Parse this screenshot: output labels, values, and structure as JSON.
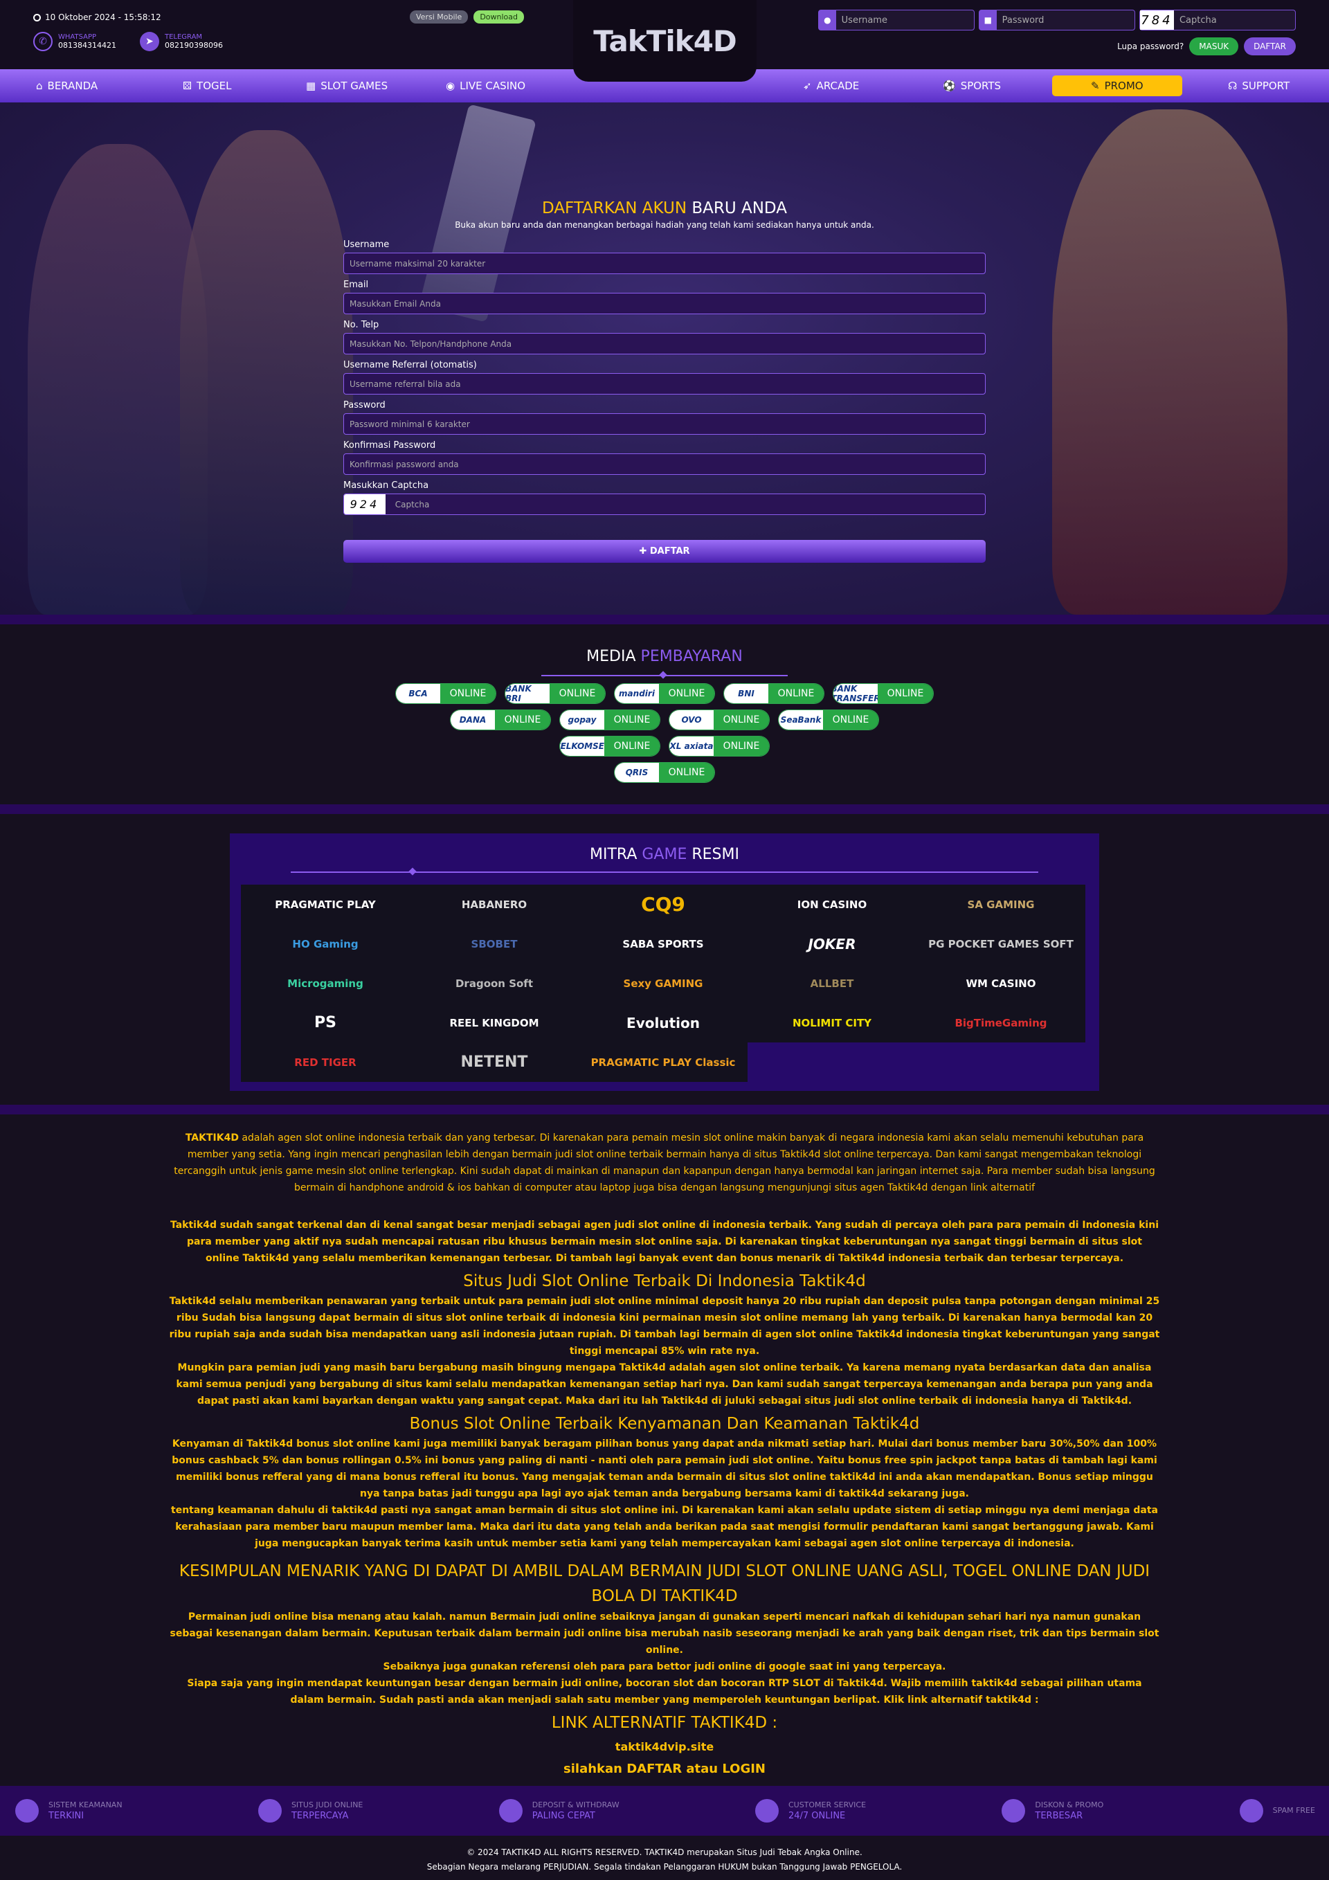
{
  "header": {
    "datetime": "10 Oktober 2024 - 15:58:12",
    "whatsapp_label": "WHATSAPP",
    "whatsapp_number": "081384314421",
    "telegram_label": "TELEGRAM",
    "telegram_number": "082190398096",
    "versi_mobile": "Versi Mobile",
    "download": "Download",
    "logo_text": "TakTik4D",
    "username_placeholder": "Username",
    "password_placeholder": "Password",
    "captcha_code": "784",
    "captcha_placeholder": "Captcha",
    "lupa_password": "Lupa password?",
    "masuk": "MASUK",
    "daftar": "DAFTAR"
  },
  "nav": {
    "items": [
      "BERANDA",
      "TOGEL",
      "SLOT GAMES",
      "LIVE CASINO",
      "ARCADE",
      "SPORTS",
      "PROMO",
      "SUPPORT"
    ]
  },
  "register": {
    "title_highlight": "DAFTARKAN AKUN",
    "title_rest": "BARU ANDA",
    "subtitle": "Buka akun baru anda dan menangkan berbagai hadiah yang telah kami sediakan hanya untuk anda.",
    "fields": [
      {
        "label": "Username",
        "placeholder": "Username maksimal 20 karakter"
      },
      {
        "label": "Email",
        "placeholder": "Masukkan Email Anda"
      },
      {
        "label": "No. Telp",
        "placeholder": "Masukkan No. Telpon/Handphone Anda"
      },
      {
        "label": "Username Referral (otomatis)",
        "placeholder": "Username referral bila ada"
      },
      {
        "label": "Password",
        "placeholder": "Password minimal 6 karakter"
      },
      {
        "label": "Konfirmasi Password",
        "placeholder": "Konfirmasi password anda"
      }
    ],
    "captcha_label": "Masukkan Captcha",
    "captcha_code": "924",
    "captcha_placeholder": "Captcha",
    "submit": "DAFTAR"
  },
  "payment": {
    "title_a": "MEDIA",
    "title_b": "PEMBAYARAN",
    "status": "ONLINE",
    "methods": [
      "BCA",
      "BANK BRI",
      "mandiri",
      "BNI",
      "BANK TRANSFER",
      "DANA",
      "gopay",
      "OVO",
      "SeaBank",
      "TELKOMSEL",
      "XL axiata",
      "QRIS"
    ]
  },
  "mitra": {
    "title_a": "MITRA",
    "title_b": "GAME",
    "title_c": "RESMI",
    "partners": [
      "PRAGMATIC PLAY",
      "HABANERO",
      "CQ9",
      "ION CASINO",
      "SA GAMING",
      "HO Gaming",
      "SBOBET",
      "SABA SPORTS",
      "JOKER",
      "PG POCKET GAMES SOFT",
      "Microgaming",
      "Dragoon Soft",
      "Sexy GAMING",
      "ALLBET",
      "WM CASINO",
      "PS",
      "REEL KINGDOM",
      "Evolution",
      "NOLIMIT CITY",
      "BigTimeGaming",
      "RED TIGER",
      "NETENT",
      "PRAGMATIC PLAY Classic"
    ]
  },
  "seo": {
    "brand": "TAKTIK4D",
    "p1": "adalah agen slot online indonesia terbaik dan yang terbesar. Di karenakan para pemain mesin slot online makin banyak di negara indonesia kami akan selalu memenuhi kebutuhan para member yang setia. Yang ingin mencari penghasilan lebih dengan bermain judi slot online terbaik bermain hanya di situs Taktik4d slot online terpercaya. Dan kami sangat mengembakan teknologi tercanggih untuk jenis game mesin slot online terlengkap. Kini sudah dapat di mainkan di manapun dan kapanpun dengan hanya bermodal kan jaringan internet saja. Para member sudah bisa langsung bermain di handphone android & ios bahkan di computer atau laptop juga bisa dengan langsung mengunjungi situs agen Taktik4d dengan link alternatif",
    "p2": "Taktik4d sudah sangat terkenal dan di kenal sangat besar menjadi sebagai agen judi slot online di indonesia terbaik. Yang sudah di percaya oleh para para pemain di Indonesia kini para member yang aktif nya sudah mencapai ratusan ribu khusus bermain mesin slot online saja. Di karenakan tingkat keberuntungan nya sangat tinggi bermain di situs slot online Taktik4d yang selalu memberikan kemenangan terbesar. Di tambah lagi banyak event dan bonus menarik di Taktik4d indonesia terbaik dan terbesar terpercaya.",
    "h1": "Situs Judi Slot Online Terbaik Di Indonesia Taktik4d",
    "p3": "Taktik4d  selalu memberikan penawaran yang terbaik untuk para pemain judi slot online minimal deposit hanya 20 ribu rupiah dan deposit pulsa tanpa potongan dengan minimal 25 ribu Sudah bisa langsung dapat bermain di situs slot online terbaik di indonesia kini permainan mesin slot online memang lah yang terbaik. Di karenakan hanya bermodal kan 20 ribu rupiah saja anda sudah bisa mendapatkan uang asli indonesia jutaan rupiah. Di tambah lagi bermain di agen slot online Taktik4d indonesia tingkat keberuntungan yang sangat tinggi mencapai 85% win rate nya.",
    "p4": "Mungkin para pemian judi yang masih baru bergabung masih bingung mengapa Taktik4d adalah agen slot online terbaik. Ya karena memang nyata berdasarkan data dan analisa kami semua penjudi yang bergabung di situs kami selalu mendapatkan kemenangan setiap hari nya. Dan kami sudah sangat terpercaya kemenangan anda berapa pun yang anda dapat pasti akan kami bayarkan dengan waktu yang sangat cepat. Maka dari itu lah Taktik4d di juluki sebagai situs judi slot online terbaik di indonesia hanya di Taktik4d.",
    "h2": "Bonus Slot Online Terbaik Kenyamanan Dan Keamanan Taktik4d",
    "p5": "Kenyaman di Taktik4d bonus slot online kami juga memiliki banyak beragam pilihan bonus yang dapat anda nikmati setiap hari. Mulai dari bonus member baru 30%,50% dan 100% bonus cashback 5% dan bonus rollingan 0.5% ini bonus yang paling di nanti - nanti oleh para pemain judi slot online. Yaitu bonus free spin jackpot tanpa batas di tambah lagi kami memiliki bonus refferal yang di mana bonus refferal itu bonus. Yang mengajak teman anda bermain di situs slot online taktik4d ini anda akan mendapatkan. Bonus setiap minggu nya tanpa batas jadi tunggu apa lagi ayo ajak teman anda bergabung bersama kami di taktik4d sekarang juga.",
    "p6": "tentang keamanan dahulu di taktik4d pasti nya sangat aman bermain di situs slot online ini. Di karenakan kami akan selalu update sistem di setiap minggu nya demi menjaga data kerahasiaan para member baru maupun member lama. Maka dari itu data yang telah anda berikan pada saat mengisi formulir pendaftaran kami sangat bertanggung jawab. Kami juga mengucapkan banyak terima kasih untuk member setia kami yang telah mempercayakan kami sebagai agen slot online terpercaya di indonesia.",
    "h3": "KESIMPULAN MENARIK YANG DI DAPAT DI AMBIL DALAM BERMAIN JUDI SLOT ONLINE UANG ASLI, TOGEL ONLINE DAN JUDI BOLA DI TAKTIK4D",
    "p7": "Permainan judi online bisa menang atau kalah. namun Bermain judi online sebaiknya jangan di gunakan seperti mencari nafkah di kehidupan sehari hari nya namun gunakan sebagai kesenangan dalam bermain. Keputusan terbaik dalam bermain judi online bisa merubah nasib seseorang menjadi ke arah yang baik dengan riset, trik dan tips bermain slot online.",
    "p8": "Sebaiknya juga gunakan referensi oleh para para bettor judi online di google saat ini yang terpercaya.",
    "p9": "Siapa saja yang ingin mendapat keuntungan besar dengan bermain judi online, bocoran slot dan bocoran RTP SLOT di Taktik4d. Wajib memilih taktik4d sebagai pilihan utama dalam bermain. Sudah pasti anda akan menjadi salah satu member yang memperoleh keuntungan berlipat. Klik link alternatif taktik4d :",
    "h4": "LINK ALTERNATIF TAKTIK4D :",
    "link": "taktik4dvip.site",
    "cta": "silahkan DAFTAR atau LOGIN"
  },
  "features": [
    {
      "t1": "SISTEM KEAMANAN",
      "t2": "TERKINI"
    },
    {
      "t1": "SITUS JUDI ONLINE",
      "t2": "TERPERCAYA"
    },
    {
      "t1": "DEPOSIT & WITHDRAW",
      "t2": "PALING CEPAT"
    },
    {
      "t1": "CUSTOMER SERVICE",
      "t2": "24/7 ONLINE"
    },
    {
      "t1": "DISKON & PROMO",
      "t2": "TERBESAR"
    },
    {
      "t1": "SPAM FREE",
      "t2": ""
    }
  ],
  "footer": {
    "line1": "© 2024 TAKTIK4D ALL RIGHTS RESERVED. TAKTIK4D merupakan Situs Judi Tebak Angka Online.",
    "line2": "Sebagian Negara melarang PERJUDIAN. Segala tindakan Pelanggaran HUKUM bukan Tanggung Jawab PENGELOLA."
  }
}
